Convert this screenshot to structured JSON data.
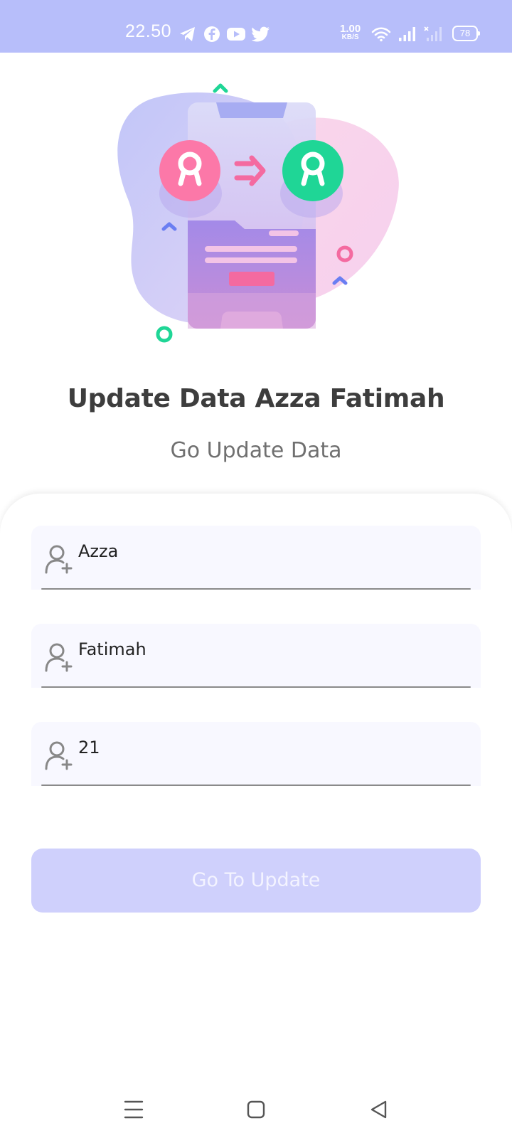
{
  "status_bar": {
    "time": "22.50",
    "net_speed_value": "1.00",
    "net_speed_unit": "KB/S",
    "battery": "78",
    "icons": [
      "telegram-icon",
      "facebook-icon",
      "youtube-icon",
      "twitter-icon",
      "wifi-icon",
      "signal-icon",
      "signal-no-sim-icon"
    ]
  },
  "header": {
    "title": "Update Data Azza Fatimah",
    "subtitle": "Go Update Data"
  },
  "form": {
    "fields": [
      {
        "value": "Azza",
        "icon": "user-add-icon"
      },
      {
        "value": "Fatimah",
        "icon": "user-add-icon"
      },
      {
        "value": "21",
        "icon": "user-add-icon"
      }
    ],
    "submit_label": "Go To Update"
  },
  "colors": {
    "status_bar": "#b7befa",
    "button": "#cfd0fc",
    "title": "#3d3d3d",
    "accent_pink": "#f46aa0",
    "accent_green": "#1dd693"
  },
  "nav_bar": {
    "icons": [
      "menu-icon",
      "home-square-icon",
      "back-triangle-icon"
    ]
  }
}
